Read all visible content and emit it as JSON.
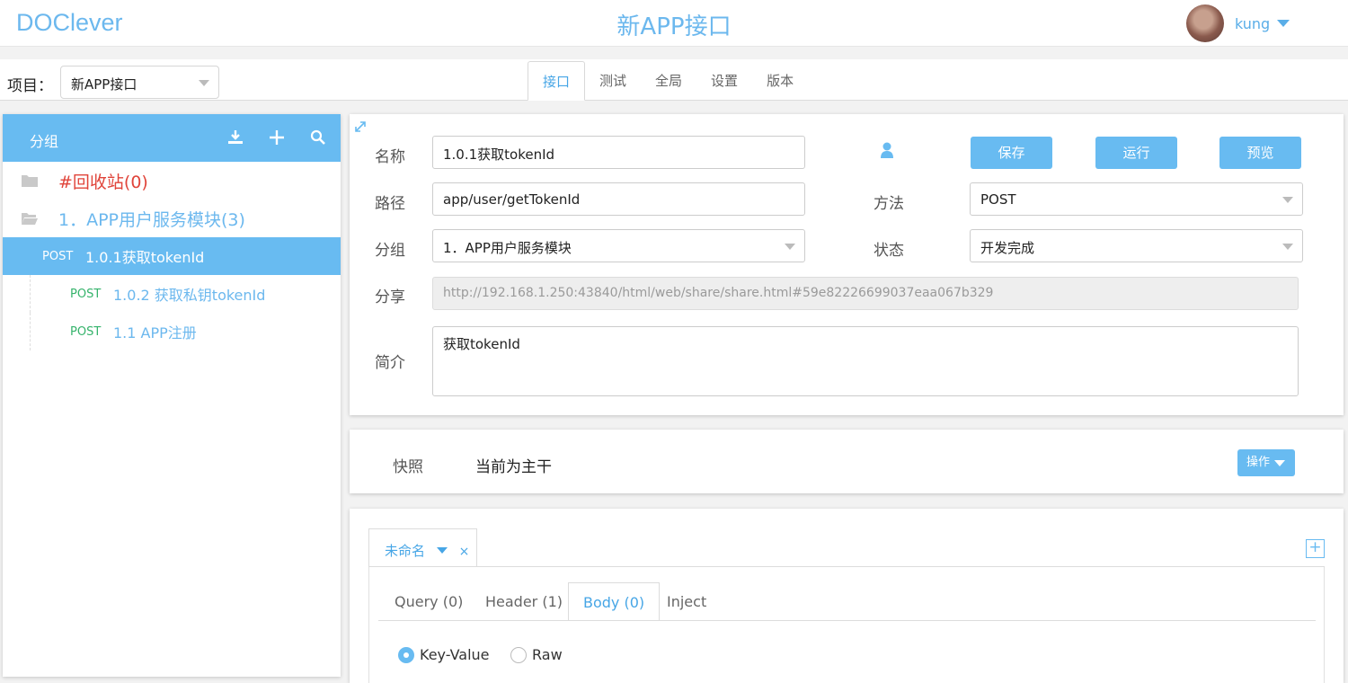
{
  "header": {
    "logo": "DOClever",
    "title": "新APP接口",
    "username": "kung"
  },
  "subbar": {
    "project_label": "项目：",
    "project_value": "新APP接口",
    "tabs": [
      {
        "label": "接口",
        "active": true
      },
      {
        "label": "测试"
      },
      {
        "label": "全局"
      },
      {
        "label": "设置"
      },
      {
        "label": "版本"
      }
    ]
  },
  "sidebar": {
    "title": "分组",
    "trash": "#回收站(0)",
    "group": "1．APP用户服务模块(3)",
    "items": [
      {
        "method": "POST",
        "name": "1.0.1获取tokenId",
        "active": true
      },
      {
        "method": "POST",
        "name": "1.0.2 获取私钥tokenId"
      },
      {
        "method": "POST",
        "name": "1.1 APP注册"
      }
    ]
  },
  "form": {
    "name_label": "名称",
    "name_value": "1.0.1获取tokenId",
    "path_label": "路径",
    "path_value": "app/user/getTokenId",
    "group_label": "分组",
    "group_value": "1．APP用户服务模块",
    "share_label": "分享",
    "share_value": "http://192.168.1.250:43840/html/web/share/share.html#59e82226699037eaa067b329",
    "desc_label": "简介",
    "desc_value": "获取tokenId",
    "method_label": "方法",
    "method_value": "POST",
    "status_label": "状态",
    "status_value": "开发完成",
    "save_label": "保存",
    "run_label": "运行",
    "preview_label": "预览"
  },
  "snapshot": {
    "label": "快照",
    "value": "当前为主干",
    "op_label": "操作"
  },
  "request": {
    "tab_label": "未命名",
    "close": "×",
    "add": "+",
    "subtabs": [
      "Query (0)",
      "Header (1)",
      "Body (0)",
      "Inject"
    ],
    "radio_kv": "Key-Value",
    "radio_raw": "Raw"
  },
  "colors": {
    "accent": "#68bbf1",
    "trash": "#e0443a",
    "method": "#35b36b"
  }
}
